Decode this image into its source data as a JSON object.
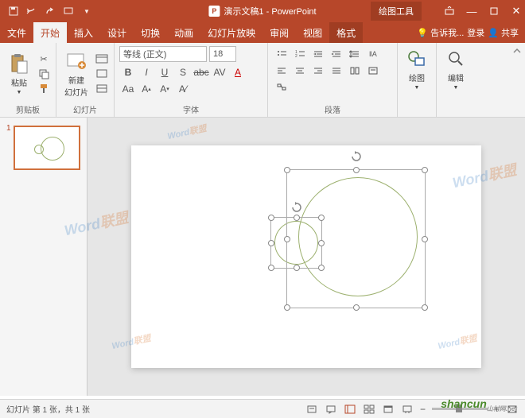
{
  "title": "演示文稿1 - PowerPoint",
  "context_tool": "绘图工具",
  "menu": {
    "file": "文件",
    "home": "开始",
    "insert": "插入",
    "design": "设计",
    "transition": "切换",
    "animation": "动画",
    "slideshow": "幻灯片放映",
    "review": "审阅",
    "view": "视图",
    "format": "格式",
    "tellme": "告诉我...",
    "login": "登录",
    "share": "共享"
  },
  "ribbon": {
    "clipboard": {
      "label": "剪贴板",
      "paste": "粘贴"
    },
    "slides": {
      "label": "幻灯片",
      "new_slide": "新建\n幻灯片"
    },
    "font": {
      "label": "字体",
      "family": "等线 (正文)",
      "size": "18"
    },
    "paragraph": {
      "label": "段落"
    },
    "drawing": {
      "label": "绘图",
      "btn": "绘图"
    },
    "editing": {
      "label": "编辑",
      "btn": "编辑"
    }
  },
  "thumb": {
    "number": "1"
  },
  "status": {
    "text": "幻灯片 第 1 张，共 1 张"
  },
  "watermark": {
    "w1": "Word",
    "w2": "联盟"
  },
  "shancun": "shancun"
}
